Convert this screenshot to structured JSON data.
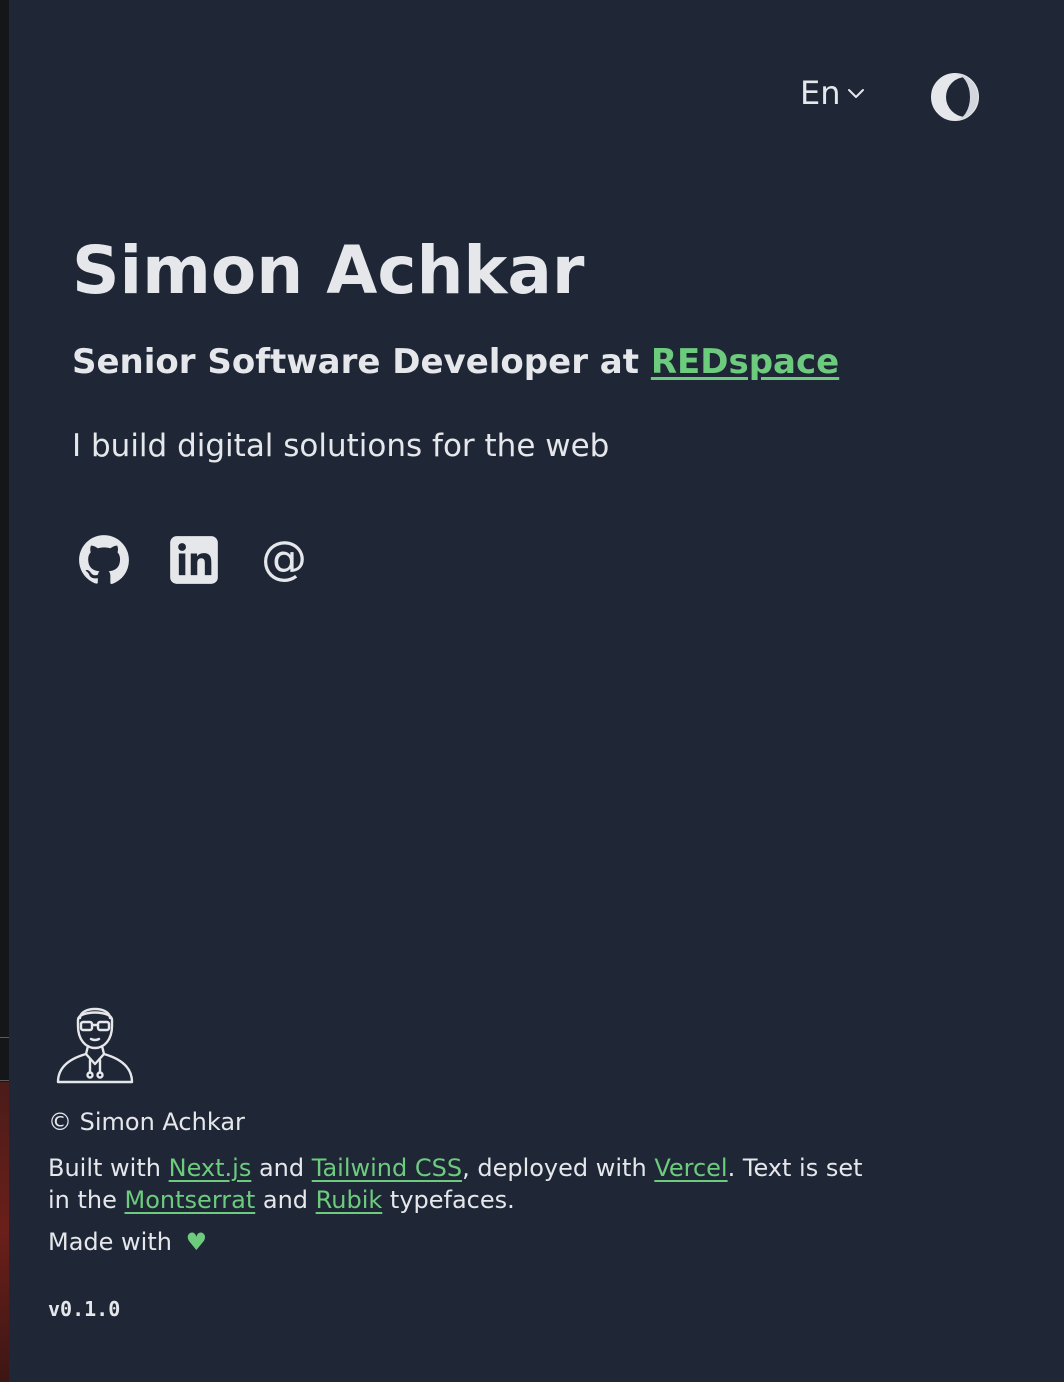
{
  "header": {
    "language": "En",
    "icons": {
      "language_chevron": "chevron-down-icon",
      "theme_toggle": "moon-icon"
    }
  },
  "hero": {
    "name": "Simon Achkar",
    "role_prefix": "Senior Software Developer at ",
    "company": "REDspace",
    "tagline": "I build digital solutions for the web"
  },
  "socials": [
    {
      "icon": "github-icon"
    },
    {
      "icon": "linkedin-icon"
    },
    {
      "icon": "at-sign-icon"
    }
  ],
  "footer": {
    "avatar_icon": "developer-avatar-icon",
    "copyright": "© Simon Achkar",
    "built": {
      "t1": "Built with ",
      "link1": "Next.js",
      "t2": " and ",
      "link2": "Tailwind CSS",
      "t3": ", deployed with ",
      "link3": "Vercel",
      "t4": ". Text is set in the ",
      "link4": "Montserrat",
      "t5": " and ",
      "link5": "Rubik",
      "t6": " typefaces."
    },
    "made_with": "Made with",
    "heart": "♥",
    "version": "v0.1.0"
  },
  "colors": {
    "background": "#1f2737",
    "text": "#e5e7eb",
    "accent": "#6ccb7d"
  }
}
